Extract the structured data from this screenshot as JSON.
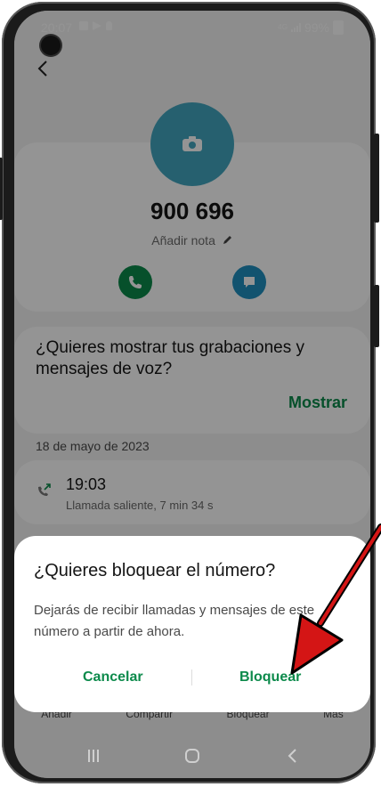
{
  "status_bar": {
    "time": "20:07",
    "network": "4G",
    "battery": "99%"
  },
  "contact": {
    "number": "900 696",
    "add_note": "Añadir nota"
  },
  "voicemail": {
    "question": "¿Quieres mostrar tus grabaciones y mensajes de voz?",
    "show_label": "Mostrar"
  },
  "history": {
    "date": "18 de mayo de 2023",
    "entries": [
      {
        "time": "19:03",
        "description": "Llamada saliente, 7 min 34 s"
      }
    ]
  },
  "bottom_actions": {
    "items": [
      "Añadir",
      "Compartir",
      "Bloquear",
      "Más"
    ]
  },
  "dialog": {
    "title": "¿Quieres bloquear el número?",
    "body": "Dejarás de recibir llamadas y mensajes de este número a partir de ahora.",
    "cancel_label": "Cancelar",
    "block_label": "Bloquear"
  },
  "colors": {
    "accent_green": "#0c8a4b",
    "avatar_blue": "#43a6bf",
    "message_blue": "#1f8fc0",
    "arrow_red": "#d41515"
  }
}
